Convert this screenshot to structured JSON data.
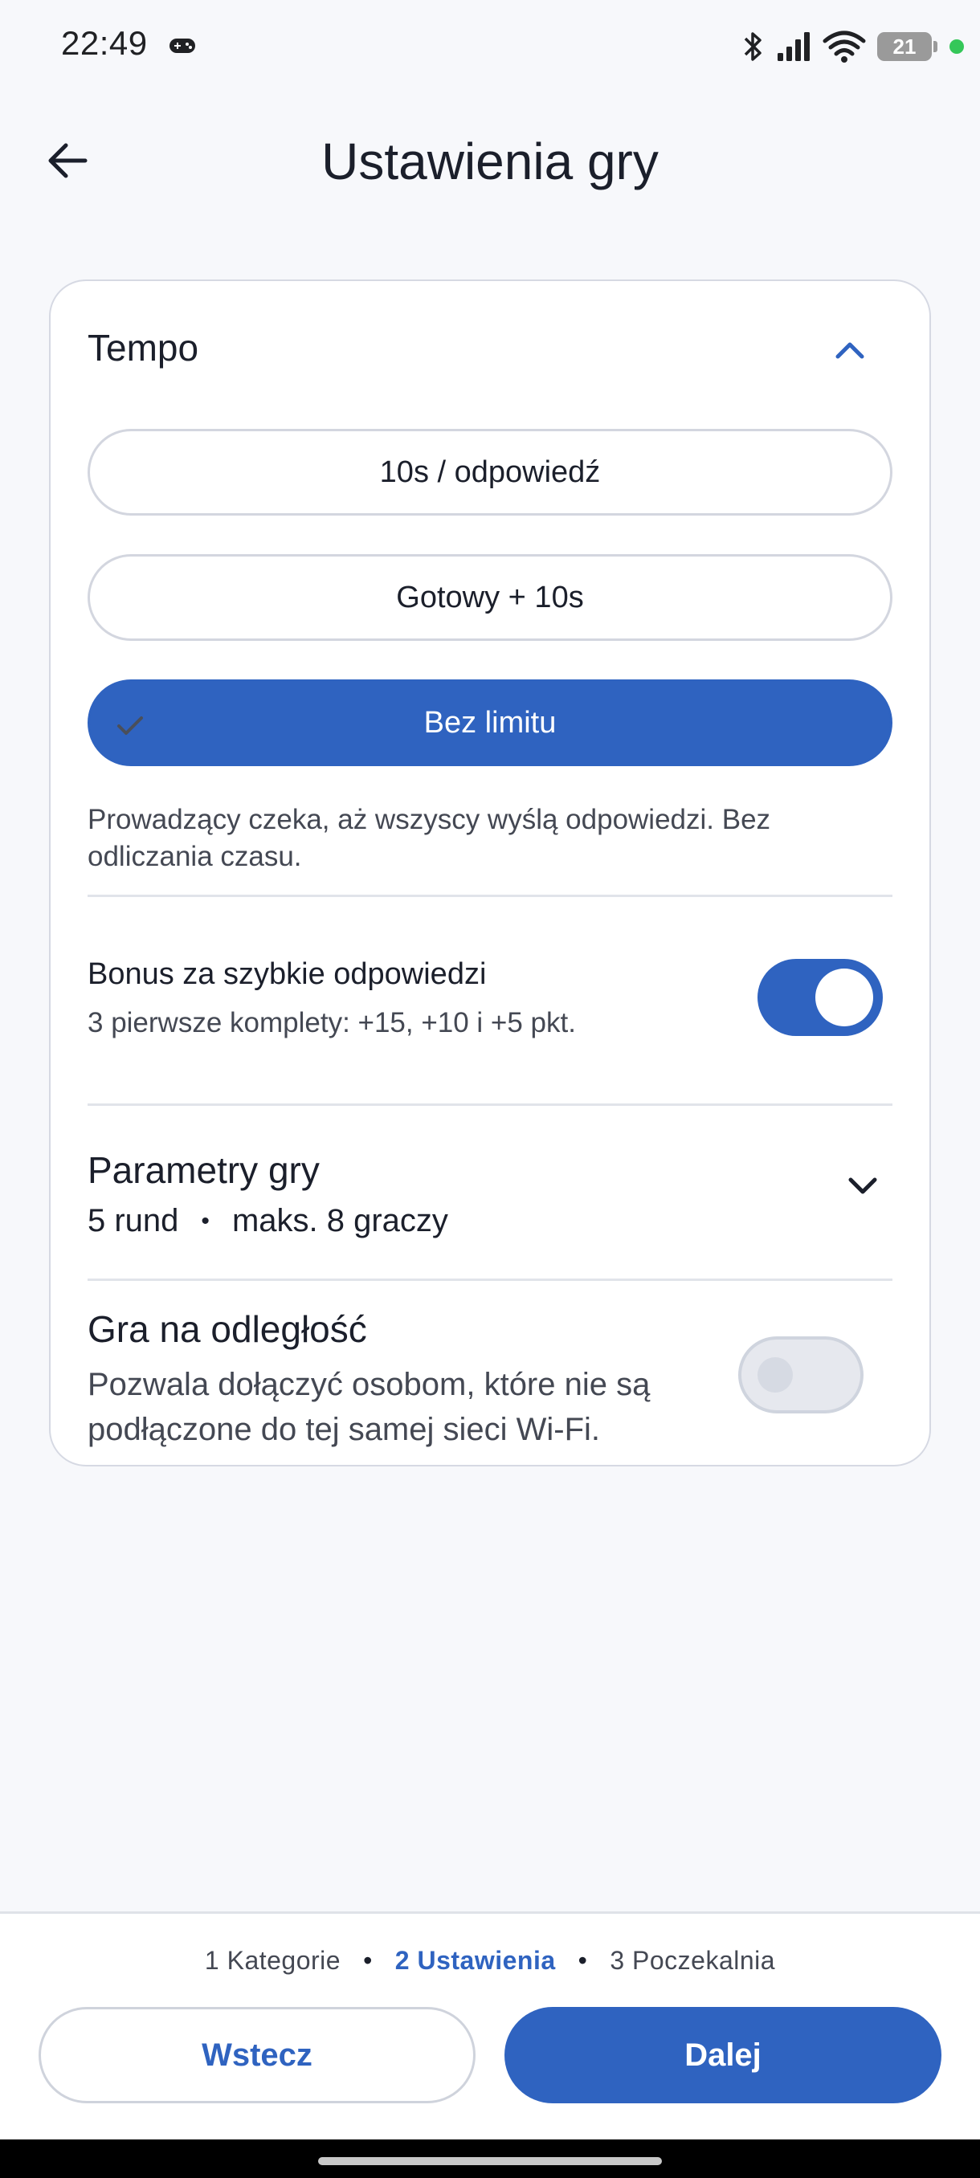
{
  "status_bar": {
    "time": "22:49",
    "battery_level": "21",
    "icons": [
      "gamepad-icon",
      "bluetooth-icon",
      "signal-icon",
      "wifi-icon",
      "battery-icon",
      "green-dot"
    ]
  },
  "header": {
    "title": "Ustawienia gry",
    "back_icon": "arrow-left-icon"
  },
  "tempo": {
    "title": "Tempo",
    "options": [
      {
        "label": "10s / odpowiedź",
        "selected": false
      },
      {
        "label": "Gotowy + 10s",
        "selected": false
      },
      {
        "label": "Bez limitu",
        "selected": true
      }
    ],
    "description": "Prowadzący czeka, aż wszyscy wyślą odpowiedzi. Bez odliczania czasu."
  },
  "bonus": {
    "title": "Bonus za szybkie odpowiedzi",
    "subtitle": "3 pierwsze komplety: +15, +10 i +5 pkt.",
    "enabled": true
  },
  "params": {
    "title": "Parametry gry",
    "rounds": "5 rund",
    "separator": "•",
    "players": "maks. 8 graczy"
  },
  "remote": {
    "title": "Gra na odległość",
    "subtitle": "Pozwala dołączyć osobom, które nie są podłączone do tej samej sieci Wi-Fi.",
    "enabled": false
  },
  "footer": {
    "steps": [
      {
        "label": "1 Kategorie",
        "active": false
      },
      {
        "label": "2 Ustawienia",
        "active": true
      },
      {
        "label": "3 Poczekalnia",
        "active": false
      }
    ],
    "step_separator": "•",
    "back_label": "Wstecz",
    "next_label": "Dalej"
  },
  "colors": {
    "accent": "#2f63c0",
    "background": "#f7f8fb",
    "card_border": "#d6d9e3",
    "status_green": "#35c759"
  }
}
